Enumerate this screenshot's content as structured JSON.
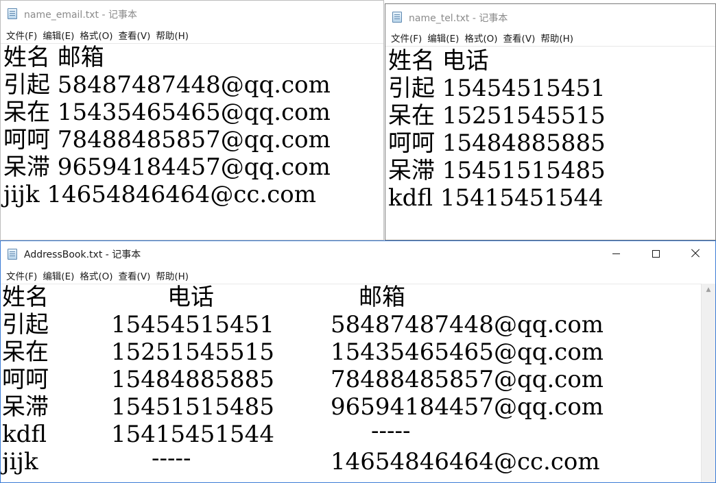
{
  "windows": {
    "email": {
      "title": "name_email.txt - 记事本",
      "menu": [
        "文件(F)",
        "编辑(E)",
        "格式(O)",
        "查看(V)",
        "帮助(H)"
      ],
      "lines": [
        "姓名 邮箱",
        "引起 58487487448@qq.com",
        "呆在 15435465465@qq.com",
        "呵呵 78488485857@qq.com",
        "呆滞 96594184457@qq.com",
        "jijk 14654846464@cc.com"
      ]
    },
    "tel": {
      "title": "name_tel.txt - 记事本",
      "menu": [
        "文件(F)",
        "编辑(E)",
        "格式(O)",
        "查看(V)",
        "帮助(H)"
      ],
      "lines": [
        "姓名 电话",
        "引起 15454515451",
        "呆在 15251545515",
        "呵呵 15484885885",
        "呆滞 15451515485",
        "kdfl 15415451544"
      ]
    },
    "address": {
      "title": "AddressBook.txt - 记事本",
      "menu": [
        "文件(F)",
        "编辑(E)",
        "格式(O)",
        "查看(V)",
        "帮助(H)"
      ],
      "header": [
        "姓名",
        "电话",
        "邮箱"
      ],
      "rows": [
        [
          "引起",
          "15454515451",
          "58487487448@qq.com"
        ],
        [
          "呆在",
          "15251545515",
          "15435465465@qq.com"
        ],
        [
          "呵呵",
          "15484885885",
          "78488485857@qq.com"
        ],
        [
          "呆滞",
          "15451515485",
          "96594184457@qq.com"
        ],
        [
          "kdfl",
          "15415451544",
          "-----"
        ],
        [
          "jijk",
          "-----",
          "14654846464@cc.com"
        ]
      ]
    }
  }
}
